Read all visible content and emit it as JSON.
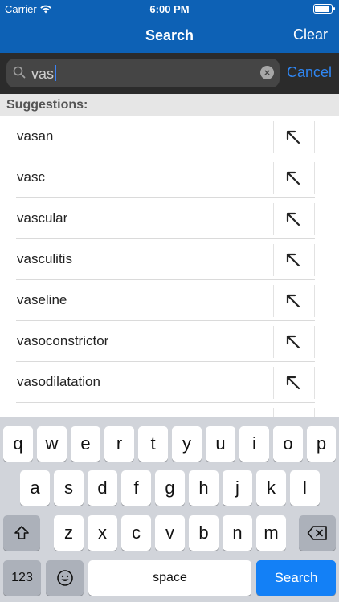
{
  "status": {
    "carrier": "Carrier",
    "time": "6:00 PM",
    "battery_level": 0.95
  },
  "nav": {
    "title": "Search",
    "clear_label": "Clear"
  },
  "search": {
    "value": "vas",
    "cancel_label": "Cancel"
  },
  "suggestions": {
    "header": "Suggestions:",
    "items": [
      "vasan",
      "vasc",
      "vascular",
      "vasculitis",
      "vaseline",
      "vasoconstrictor",
      "vasodilatation",
      ""
    ]
  },
  "keyboard": {
    "row1": [
      "q",
      "w",
      "e",
      "r",
      "t",
      "y",
      "u",
      "i",
      "o",
      "p"
    ],
    "row2": [
      "a",
      "s",
      "d",
      "f",
      "g",
      "h",
      "j",
      "k",
      "l"
    ],
    "row3": [
      "z",
      "x",
      "c",
      "v",
      "b",
      "n",
      "m"
    ],
    "numbers_label": "123",
    "space_label": "space",
    "search_label": "Search"
  },
  "colors": {
    "accent": "#0d61b5",
    "link": "#2f86f2",
    "keyboard_bg": "#d1d4da",
    "search_key": "#1380f6"
  }
}
